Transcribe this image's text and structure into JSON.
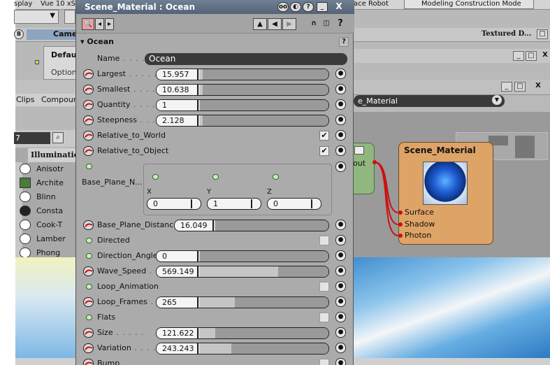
{
  "background": {
    "menu_items": [
      "splay",
      "Vue 10 xS",
      "ace Robot",
      "Modeling Construction Mode"
    ],
    "camera_tab": "Came",
    "textured_label": "Textured D...",
    "default_label": "Defau",
    "options_label": "Options",
    "menu_clips": "Clips",
    "menu_compound": "Compound",
    "material_dropdown": "e_Material",
    "illumination_header": "Illumination",
    "shader_list": [
      "Anisotr",
      "Archite",
      "Blinn",
      "Consta",
      "Cook-T",
      "Lamber",
      "Phong"
    ],
    "search_value": "7",
    "node_out": "out",
    "node_title": "Scene_Material",
    "node_ports": [
      "Surface",
      "Shadow",
      "Photon"
    ]
  },
  "panel": {
    "title": "Scene_Material : Ocean",
    "section": "Ocean",
    "help": "?",
    "name_label": "Name",
    "name_value": "Ocean",
    "params": [
      {
        "label": "Largest",
        "value": "15.957",
        "fill": 0.02,
        "kind": "slider",
        "icon": "anim"
      },
      {
        "label": "Smallest",
        "value": "10.638",
        "fill": 0.02,
        "kind": "slider",
        "icon": "anim"
      },
      {
        "label": "Quantity",
        "value": "1",
        "fill": 0.0,
        "kind": "slider",
        "icon": "anim"
      },
      {
        "label": "Steepness",
        "value": "2.128",
        "fill": 0.02,
        "kind": "slider",
        "icon": "anim"
      },
      {
        "label": "Relative_to_World",
        "checked": true,
        "kind": "check",
        "icon": "anim"
      },
      {
        "label": "Relative_to_Object",
        "checked": true,
        "kind": "check",
        "icon": "anim"
      }
    ],
    "vector": {
      "label": "Base_Plane_N...",
      "axes": [
        "X",
        "Y",
        "Z"
      ],
      "values": [
        "0",
        "1",
        "0"
      ]
    },
    "params2": [
      {
        "label": "Base_Plane_Distance",
        "value": "16.049",
        "fill": 0.0,
        "kind": "slider",
        "icon": "anim"
      },
      {
        "label": "Directed",
        "checked": false,
        "kind": "check",
        "icon": "dot"
      },
      {
        "label": "Direction_Angle",
        "value": "0",
        "fill": 0.0,
        "kind": "slider",
        "icon": "dot"
      },
      {
        "label": "Wave_Speed",
        "value": "569.149",
        "fill": 0.6,
        "kind": "slider",
        "icon": "anim"
      },
      {
        "label": "Loop_Animation",
        "checked": false,
        "kind": "check",
        "icon": "dot"
      },
      {
        "label": "Loop_Frames",
        "value": "265",
        "fill": 0.27,
        "kind": "slider",
        "icon": "anim"
      },
      {
        "label": "Flats",
        "checked": false,
        "kind": "check",
        "icon": "dot"
      },
      {
        "label": "Size",
        "value": "121.622",
        "fill": 0.12,
        "kind": "slider",
        "icon": "anim"
      },
      {
        "label": "Variation",
        "value": "243.243",
        "fill": 0.24,
        "kind": "slider",
        "icon": "anim"
      },
      {
        "label": "Bump",
        "checked": false,
        "kind": "check",
        "icon": "anim"
      }
    ]
  }
}
